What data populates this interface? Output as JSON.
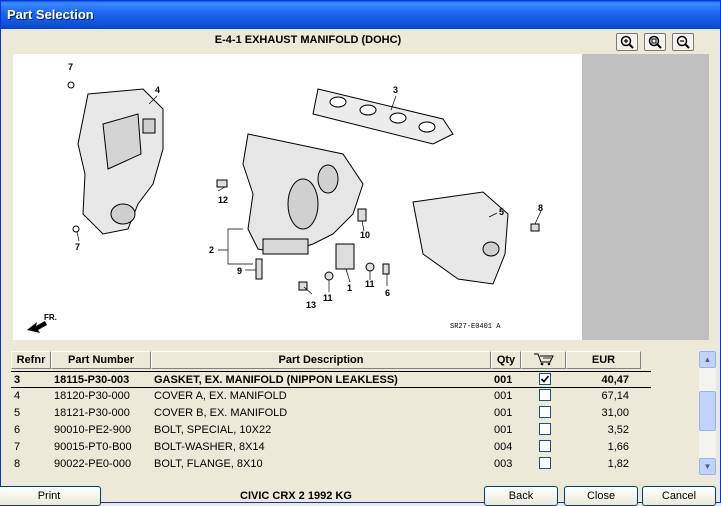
{
  "window": {
    "title": "Part Selection"
  },
  "diagram": {
    "title": "E-4-1 EXHAUST MANIFOLD (DOHC)",
    "code": "SR27-E0401 A",
    "direction_label": "FR.",
    "callouts": [
      "7",
      "4",
      "3",
      "12",
      "2",
      "9",
      "13",
      "11",
      "1",
      "11",
      "6",
      "10",
      "5",
      "8",
      "7"
    ]
  },
  "zoom": {
    "zoom_in_icon": "zoom-in-icon",
    "zoom_fit_icon": "zoom-fit-icon",
    "zoom_out_icon": "zoom-out-icon"
  },
  "table": {
    "headers": {
      "refnr": "Refnr",
      "part_number": "Part Number",
      "description": "Part Description",
      "qty": "Qty",
      "cart_icon": "cart-icon",
      "eur": "EUR"
    },
    "rows": [
      {
        "refnr": "3",
        "part_number": "18115-P30-003",
        "description": "GASKET, EX. MANIFOLD (NIPPON LEAKLESS)",
        "qty": "001",
        "checked": true,
        "eur": "40,47"
      },
      {
        "refnr": "4",
        "part_number": "18120-P30-000",
        "description": "COVER A, EX. MANIFOLD",
        "qty": "001",
        "checked": false,
        "eur": "67,14"
      },
      {
        "refnr": "5",
        "part_number": "18121-P30-000",
        "description": "COVER B, EX. MANIFOLD",
        "qty": "001",
        "checked": false,
        "eur": "31,00"
      },
      {
        "refnr": "6",
        "part_number": "90010-PE2-900",
        "description": "BOLT, SPECIAL, 10X22",
        "qty": "001",
        "checked": false,
        "eur": "3,52"
      },
      {
        "refnr": "7",
        "part_number": "90015-PT0-B00",
        "description": "BOLT-WASHER, 8X14",
        "qty": "004",
        "checked": false,
        "eur": "1,66"
      },
      {
        "refnr": "8",
        "part_number": "90022-PE0-000",
        "description": "BOLT, FLANGE, 8X10",
        "qty": "003",
        "checked": false,
        "eur": "1,82"
      }
    ]
  },
  "footer": {
    "print_label": "Print",
    "vehicle": "CIVIC CRX 2 1992 KG",
    "back_label": "Back",
    "close_label": "Close",
    "cancel_label": "Cancel"
  }
}
